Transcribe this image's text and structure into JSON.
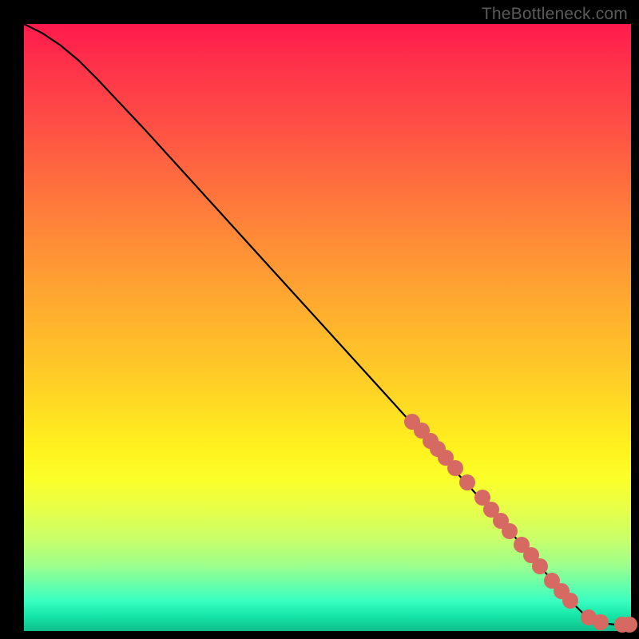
{
  "watermark": "TheBottleneck.com",
  "chart_data": {
    "type": "line",
    "title": "",
    "xlabel": "",
    "ylabel": "",
    "xlim": [
      0,
      100
    ],
    "ylim": [
      0,
      100
    ],
    "curve": [
      {
        "x": 0,
        "y": 100
      },
      {
        "x": 3,
        "y": 98.5
      },
      {
        "x": 6,
        "y": 96.5
      },
      {
        "x": 9,
        "y": 94
      },
      {
        "x": 12,
        "y": 91
      },
      {
        "x": 20,
        "y": 82.5
      },
      {
        "x": 30,
        "y": 71.5
      },
      {
        "x": 40,
        "y": 60.5
      },
      {
        "x": 50,
        "y": 49.5
      },
      {
        "x": 60,
        "y": 38.5
      },
      {
        "x": 70,
        "y": 27.5
      },
      {
        "x": 80,
        "y": 16.5
      },
      {
        "x": 86,
        "y": 9.5
      },
      {
        "x": 90,
        "y": 5
      },
      {
        "x": 92,
        "y": 3
      },
      {
        "x": 94,
        "y": 1.8
      },
      {
        "x": 96,
        "y": 1.2
      },
      {
        "x": 98,
        "y": 1
      },
      {
        "x": 99.8,
        "y": 1
      }
    ],
    "series": [
      {
        "name": "markers",
        "points": [
          {
            "x": 64,
            "y": 34.5
          },
          {
            "x": 65.5,
            "y": 33
          },
          {
            "x": 67,
            "y": 31.3
          },
          {
            "x": 68.2,
            "y": 30
          },
          {
            "x": 69.5,
            "y": 28.5
          },
          {
            "x": 71,
            "y": 26.8
          },
          {
            "x": 73,
            "y": 24.5
          },
          {
            "x": 75.5,
            "y": 22
          },
          {
            "x": 77,
            "y": 20
          },
          {
            "x": 78.5,
            "y": 18.2
          },
          {
            "x": 80,
            "y": 16.5
          },
          {
            "x": 82,
            "y": 14.2
          },
          {
            "x": 83.5,
            "y": 12.5
          },
          {
            "x": 85,
            "y": 10.7
          },
          {
            "x": 87,
            "y": 8.3
          },
          {
            "x": 88.5,
            "y": 6.6
          },
          {
            "x": 90,
            "y": 5
          },
          {
            "x": 93,
            "y": 2.2
          },
          {
            "x": 95,
            "y": 1.4
          },
          {
            "x": 98.5,
            "y": 1
          },
          {
            "x": 99.8,
            "y": 1
          }
        ]
      }
    ],
    "colors": {
      "curve": "#000000",
      "markers": "#d66a62"
    }
  }
}
